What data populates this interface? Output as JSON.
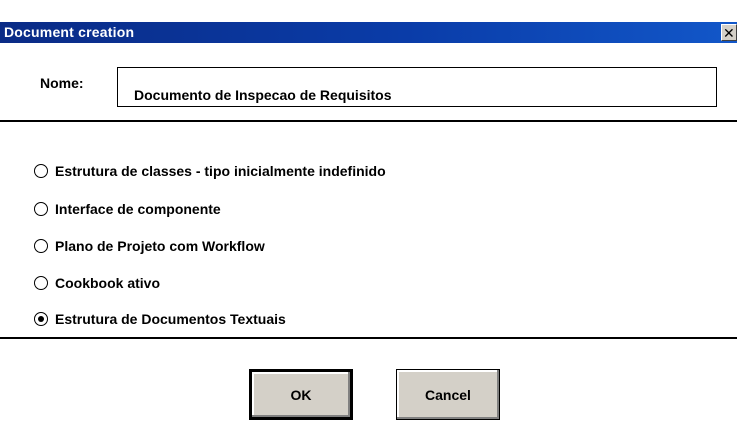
{
  "window": {
    "title": "Document creation",
    "close_glyph": "✕"
  },
  "form": {
    "name_label": "Nome:",
    "name_value": "Documento de Inspecao de Requisitos"
  },
  "options": [
    {
      "label": "Estrutura de classes - tipo inicialmente indefinido",
      "selected": false
    },
    {
      "label": "Interface de componente",
      "selected": false
    },
    {
      "label": "Plano de Projeto com Workflow",
      "selected": false
    },
    {
      "label": "Cookbook ativo",
      "selected": false
    },
    {
      "label": "Estrutura de Documentos Textuais",
      "selected": true
    }
  ],
  "buttons": {
    "ok_label": "OK",
    "cancel_label": "Cancel"
  },
  "colors": {
    "titlebar": "#0a2b86",
    "button_face": "#d4d0c8"
  }
}
